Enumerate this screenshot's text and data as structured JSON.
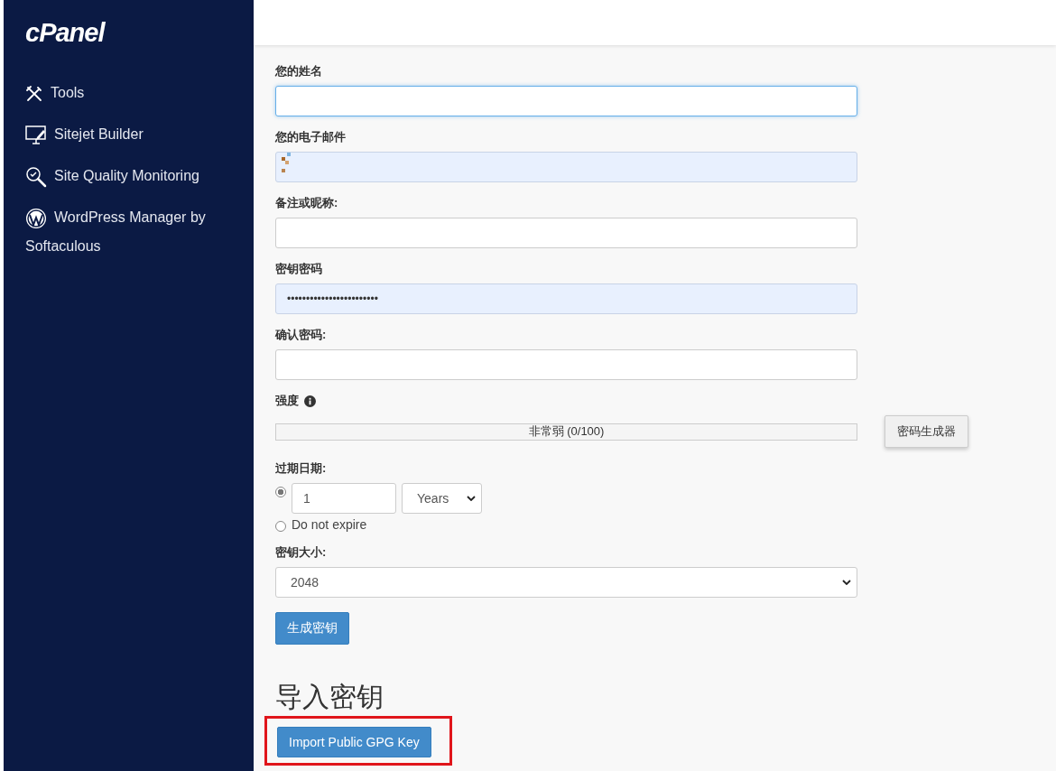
{
  "sidebar": {
    "logo": "cPanel",
    "items": [
      {
        "label": "Tools"
      },
      {
        "label": "Sitejet Builder"
      },
      {
        "label": "Site Quality Monitoring"
      },
      {
        "label": "WordPress Manager by Softaculous"
      }
    ]
  },
  "fields": [
    {
      "label": "您的姓名",
      "focused": true,
      "autofilled": false,
      "redacted": false
    },
    {
      "label": "您的电子邮件",
      "focused": false,
      "autofilled": true,
      "redacted": true
    },
    {
      "label": "备注或昵称:",
      "focused": false,
      "autofilled": false,
      "redacted": false
    },
    {
      "label": "密钥密码",
      "value": "••••••••••••••••••••••••",
      "focused": false,
      "autofilled": true,
      "redacted": false
    },
    {
      "label": "确认密码:",
      "focused": false,
      "autofilled": false,
      "redacted": false
    }
  ],
  "strength": {
    "label": "强度",
    "level": 0,
    "reading": "非常弱 (0/100)",
    "generator_button": "密码生成器"
  },
  "expiration": {
    "label": "过期日期:",
    "options": [
      {
        "kind": "duration",
        "selected": true,
        "value": "1",
        "unit": "Years"
      },
      {
        "kind": "never",
        "selected": false,
        "label": "Do not expire"
      }
    ]
  },
  "key_size": {
    "label": "密钥大小:",
    "value": "2048"
  },
  "generate_button": "生成密钥",
  "import": {
    "heading": "导入密钥",
    "button": "Import Public GPG Key",
    "highlighted": true
  }
}
